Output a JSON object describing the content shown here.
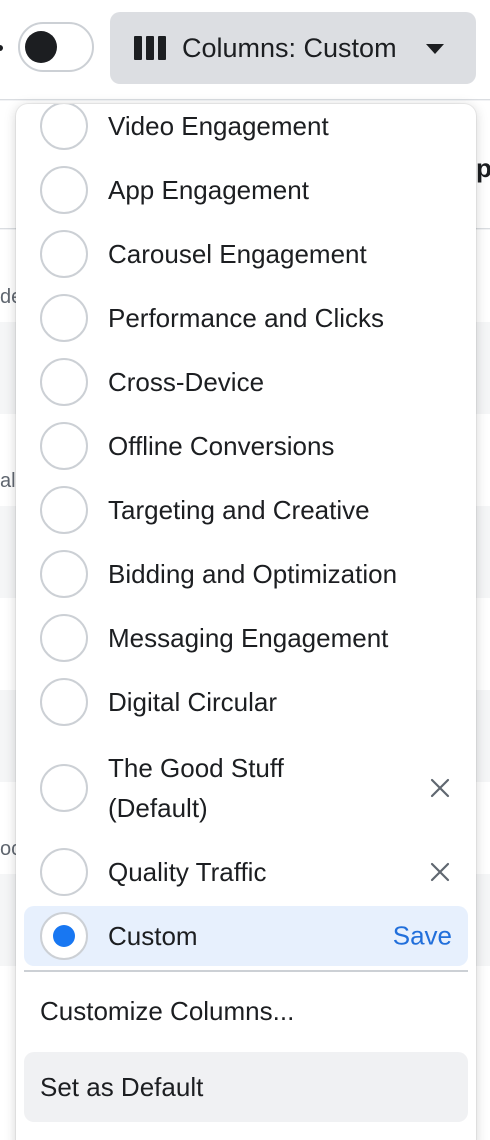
{
  "header": {
    "columns_button_label": "Columns: Custom",
    "toggle_state": "off"
  },
  "background": {
    "peek_texts": [
      "de",
      "ali",
      "oc"
    ],
    "peek_bold": "p"
  },
  "dropdown": {
    "options": [
      {
        "label": "Video Engagement",
        "removable": false
      },
      {
        "label": "App Engagement",
        "removable": false
      },
      {
        "label": "Carousel Engagement",
        "removable": false
      },
      {
        "label": "Performance and Clicks",
        "removable": false
      },
      {
        "label": "Cross-Device",
        "removable": false
      },
      {
        "label": "Offline Conversions",
        "removable": false
      },
      {
        "label": "Targeting and Creative",
        "removable": false
      },
      {
        "label": "Bidding and Optimization",
        "removable": false
      },
      {
        "label": "Messaging Engagement",
        "removable": false
      },
      {
        "label": "Digital Circular",
        "removable": false
      },
      {
        "label_line1": "The Good Stuff",
        "label_line2": "(Default)",
        "removable": true
      },
      {
        "label": "Quality Traffic",
        "removable": true
      },
      {
        "label": "Custom",
        "selected": true,
        "save_label": "Save"
      }
    ],
    "customize_label": "Customize Columns...",
    "set_default_label": "Set as Default"
  },
  "colors": {
    "accent": "#1877f2",
    "save_link": "#216fdb",
    "selected_bg": "#e7f0fd"
  }
}
